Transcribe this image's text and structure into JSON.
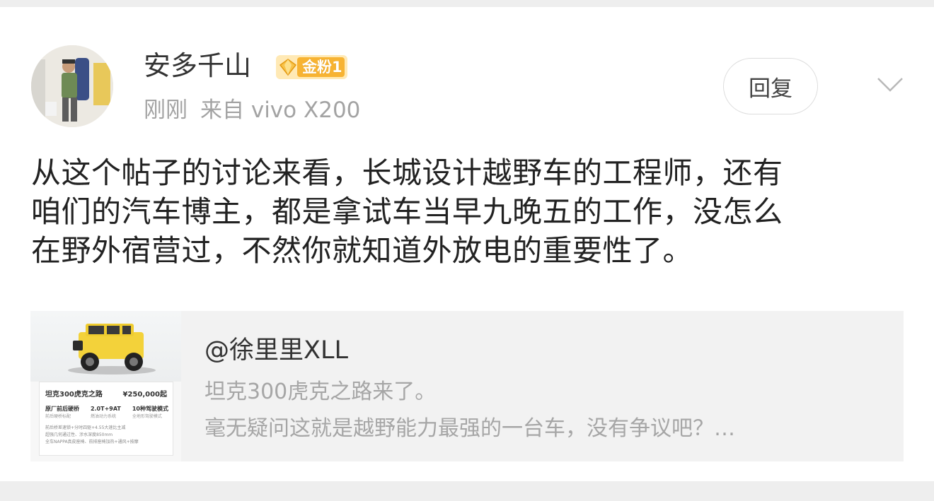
{
  "post": {
    "username": "安多千山",
    "badge": "金粉1",
    "time": "刚刚",
    "source": "来自 vivo X200",
    "reply_label": "回复",
    "content_lines": [
      "从这个帖子的讨论来看，长城设计越野车的工程师，还有",
      "咱们的汽车博主，都是拿试车当早九晚五的工作，没怎么",
      "在野外宿营过，不然你就知道外放电的重要性了。"
    ]
  },
  "repost": {
    "author": "@徐里里XLL",
    "line1": "坦克300虎克之路来了。",
    "line2": "毫无疑问这就是越野能力最强的一台车，没有争议吧？…",
    "thumbnail": {
      "title": "坦克300虎克之路",
      "price": "¥250,000起",
      "specs": [
        {
          "a": "原厂前后硬桥",
          "b": "前后硬桥标配"
        },
        {
          "a": "2.0T+9AT",
          "b": "燃油动力系统"
        },
        {
          "a": "10种驾驶模式",
          "b": "全地形驾驶模式"
        }
      ],
      "notes": [
        "前后桥差速锁+分时四驱+4.55大速比主减",
        "超强几何通过性、涉水深度850mm",
        "全车NAPPA真皮座椅、前排座椅加热+通风+按摩"
      ]
    }
  },
  "colors": {
    "badge_gold": "#f7b333",
    "meta_gray": "#a3a3a3",
    "repost_bg": "#f2f2f2"
  },
  "icons": [
    "avatar-photo",
    "gold-diamond-icon",
    "chevron-down-icon",
    "car-thumbnail"
  ]
}
